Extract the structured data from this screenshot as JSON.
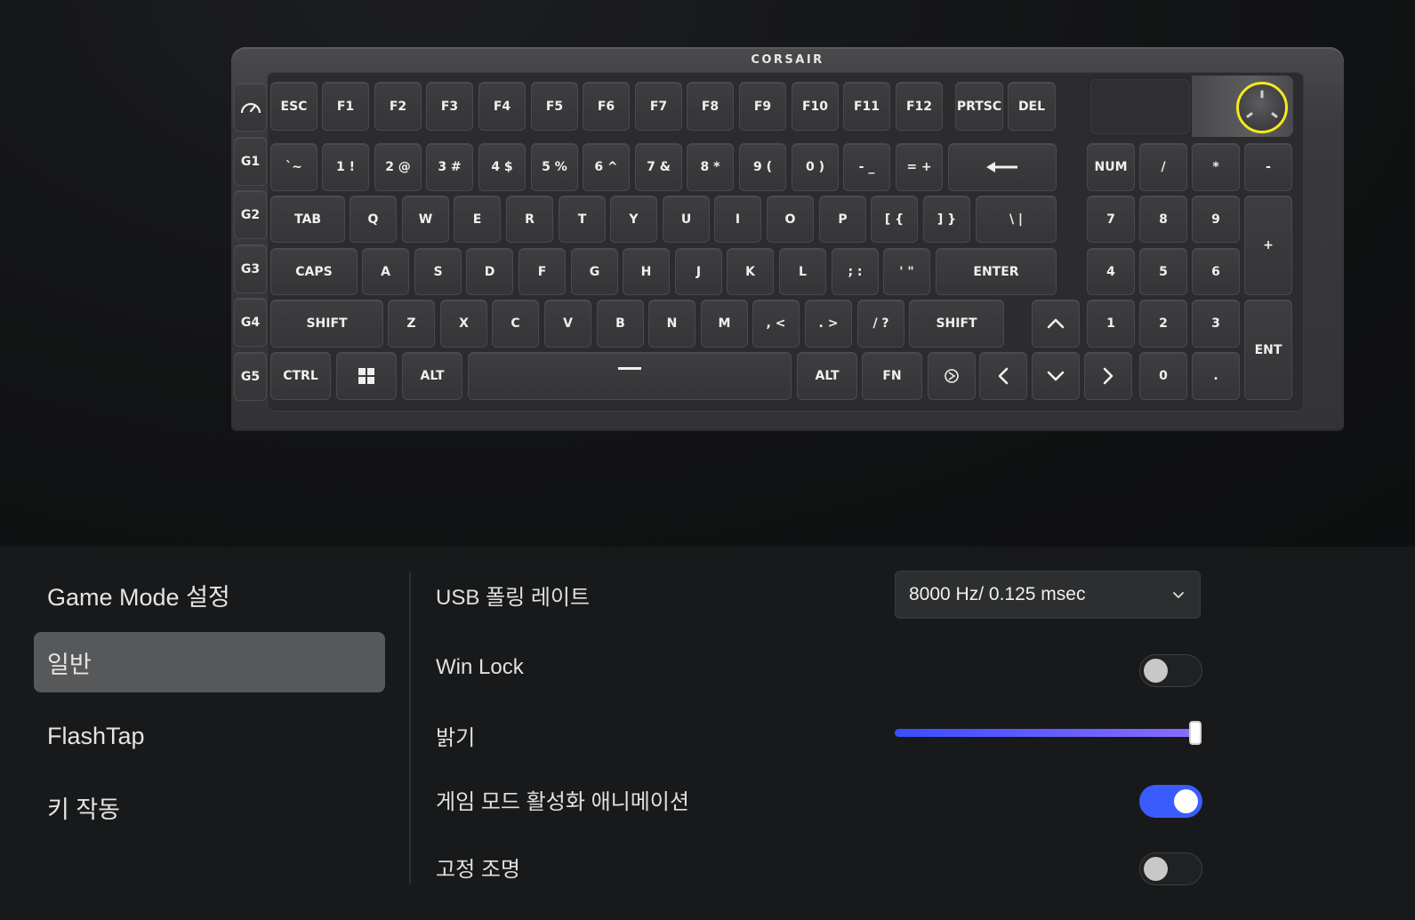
{
  "keyboard": {
    "brand": "CORSAIR",
    "macro_keys": [
      "G1",
      "G2",
      "G3",
      "G4",
      "G5"
    ],
    "row_function": [
      "ESC",
      "F1",
      "F2",
      "F3",
      "F4",
      "F5",
      "F6",
      "F7",
      "F8",
      "F9",
      "F10",
      "F11",
      "F12",
      "PRTSC",
      "DEL"
    ],
    "row_number": [
      "`~",
      "1 !",
      "2 @",
      "3 #",
      "4 $",
      "5 %",
      "6 ^",
      "7 &",
      "8 *",
      "9 (",
      "0 )",
      "- _",
      "= +"
    ],
    "row_tab": [
      "TAB",
      "Q",
      "W",
      "E",
      "R",
      "T",
      "Y",
      "U",
      "I",
      "O",
      "P",
      "[ {",
      "] }",
      "\\ |"
    ],
    "row_caps": [
      "CAPS",
      "A",
      "S",
      "D",
      "F",
      "G",
      "H",
      "J",
      "K",
      "L",
      "; :",
      "' \"",
      "ENTER"
    ],
    "row_shift": [
      "SHIFT",
      "Z",
      "X",
      "C",
      "V",
      "B",
      "N",
      "M",
      ", <",
      ". >",
      "/ ?",
      "SHIFT"
    ],
    "row_bottom": [
      "CTRL",
      "ALT",
      "ALT",
      "FN"
    ],
    "numpad": {
      "top": [
        "NUM",
        "/",
        "*",
        "-"
      ],
      "row1": [
        "7",
        "8",
        "9"
      ],
      "row2": [
        "4",
        "5",
        "6"
      ],
      "row3": [
        "1",
        "2",
        "3"
      ],
      "row4": [
        "0",
        "."
      ],
      "plus": "+",
      "enter": "ENT"
    },
    "knob_highlight_color": "#f3ea1b"
  },
  "sidebar": {
    "title": "Game Mode 설정",
    "items": [
      {
        "label": "일반",
        "active": true
      },
      {
        "label": "FlashTap",
        "active": false
      },
      {
        "label": "키 작동",
        "active": false
      }
    ]
  },
  "settings": {
    "usb_polling": {
      "label": "USB 폴링 레이트",
      "value": "8000 Hz/ 0.125 msec"
    },
    "win_lock": {
      "label": "Win Lock",
      "enabled": false
    },
    "brightness": {
      "label": "밝기",
      "value": 1.0
    },
    "game_mode_animation": {
      "label": "게임 모드 활성화 애니메이션",
      "enabled": true
    },
    "static_lighting": {
      "label": "고정 조명",
      "enabled": false
    }
  },
  "colors": {
    "accent": "#3a5cff",
    "slider_start": "#3a4dff",
    "slider_end": "#8a6cff"
  }
}
